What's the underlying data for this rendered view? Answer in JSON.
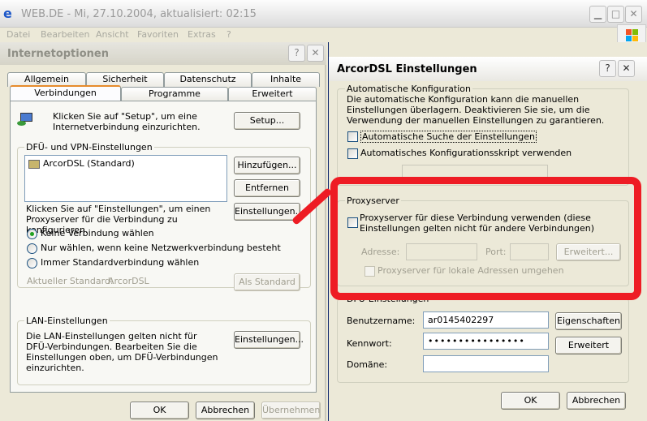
{
  "background_window": {
    "title": "WEB.DE - Mi, 27.10.2004, aktualisiert: 02:15",
    "menu": [
      "Datei",
      "Bearbeiten",
      "Ansicht",
      "Favoriten",
      "Extras",
      "?"
    ]
  },
  "internet_options": {
    "title": "Internetoptionen",
    "tabs_row1": [
      "Allgemein",
      "Sicherheit",
      "Datenschutz",
      "Inhalte"
    ],
    "tabs_row2": [
      "Verbindungen",
      "Programme",
      "Erweitert"
    ],
    "setup_text": "Klicken Sie auf \"Setup\", um eine Internetverbindung einzurichten.",
    "setup_button": "Setup...",
    "dfu_group": "DFÜ- und VPN-Einstellungen",
    "connections": [
      "ArcorDSL (Standard)"
    ],
    "add_button": "Hinzufügen...",
    "remove_button": "Entfernen",
    "settings_text": "Klicken Sie auf \"Einstellungen\", um einen Proxyserver für die Verbindung zu konfigurieren.",
    "settings_button": "Einstellungen...",
    "radio_options": [
      "Keine Verbindung wählen",
      "Nur wählen, wenn keine Netzwerkverbindung besteht",
      "Immer Standardverbindung wählen"
    ],
    "current_default_label": "Aktueller Standard:",
    "current_default_value": "ArcorDSL",
    "as_default_button": "Als Standard",
    "lan_group": "LAN-Einstellungen",
    "lan_text": "Die LAN-Einstellungen gelten nicht für DFÜ-Verbindungen. Bearbeiten Sie die Einstellungen oben, um DFÜ-Verbindungen einzurichten.",
    "lan_button": "Einstellungen...",
    "ok_button": "OK",
    "cancel_button": "Abbrechen",
    "apply_button": "Übernehmen"
  },
  "arcor_dialog": {
    "title": "ArcorDSL Einstellungen",
    "auto_group": "Automatische Konfiguration",
    "auto_text": "Die automatische Konfiguration kann die manuellen Einstellungen überlagern. Deaktivieren Sie sie, um die Verwendung der manuellen Einstellungen zu garantieren.",
    "auto_detect": "Automatische Suche der Einstellungen",
    "auto_script": "Automatisches Konfigurationsskript verwenden",
    "proxy_group": "Proxyserver",
    "proxy_use": "Proxyserver für diese Verbindung verwenden (diese Einstellungen gelten nicht für andere Verbindungen)",
    "address_label": "Adresse:",
    "port_label": "Port:",
    "advanced_button": "Erweitert...",
    "bypass_local": "Proxyserver für lokale Adressen umgehen",
    "dfu_group": "DFÜ-Einstellungen",
    "username_label": "Benutzername:",
    "username_value": "ar0145402297",
    "password_label": "Kennwort:",
    "password_value": "••••••••••••••••",
    "domain_label": "Domäne:",
    "domain_value": "",
    "properties_button": "Eigenschaften",
    "advanced2_button": "Erweitert",
    "ok_button": "OK",
    "cancel_button": "Abbrechen"
  },
  "colors": {
    "highlight": "#ee1c24",
    "dialog_bg": "#ece9d8",
    "group_title": "#0046d5"
  }
}
